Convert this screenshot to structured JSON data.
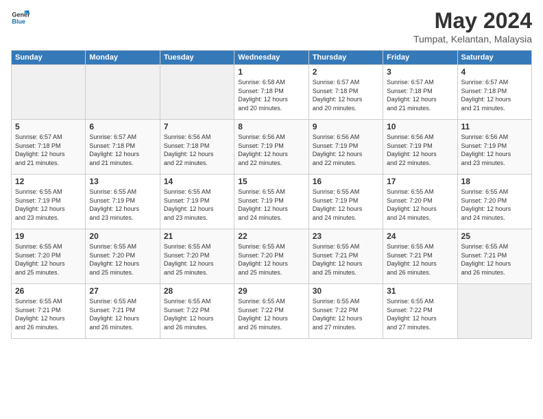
{
  "header": {
    "logo_line1": "General",
    "logo_line2": "Blue",
    "month": "May 2024",
    "location": "Tumpat, Kelantan, Malaysia"
  },
  "weekdays": [
    "Sunday",
    "Monday",
    "Tuesday",
    "Wednesday",
    "Thursday",
    "Friday",
    "Saturday"
  ],
  "weeks": [
    [
      {
        "day": "",
        "info": ""
      },
      {
        "day": "",
        "info": ""
      },
      {
        "day": "",
        "info": ""
      },
      {
        "day": "1",
        "info": "Sunrise: 6:58 AM\nSunset: 7:18 PM\nDaylight: 12 hours\nand 20 minutes."
      },
      {
        "day": "2",
        "info": "Sunrise: 6:57 AM\nSunset: 7:18 PM\nDaylight: 12 hours\nand 20 minutes."
      },
      {
        "day": "3",
        "info": "Sunrise: 6:57 AM\nSunset: 7:18 PM\nDaylight: 12 hours\nand 21 minutes."
      },
      {
        "day": "4",
        "info": "Sunrise: 6:57 AM\nSunset: 7:18 PM\nDaylight: 12 hours\nand 21 minutes."
      }
    ],
    [
      {
        "day": "5",
        "info": "Sunrise: 6:57 AM\nSunset: 7:18 PM\nDaylight: 12 hours\nand 21 minutes."
      },
      {
        "day": "6",
        "info": "Sunrise: 6:57 AM\nSunset: 7:18 PM\nDaylight: 12 hours\nand 21 minutes."
      },
      {
        "day": "7",
        "info": "Sunrise: 6:56 AM\nSunset: 7:18 PM\nDaylight: 12 hours\nand 22 minutes."
      },
      {
        "day": "8",
        "info": "Sunrise: 6:56 AM\nSunset: 7:19 PM\nDaylight: 12 hours\nand 22 minutes."
      },
      {
        "day": "9",
        "info": "Sunrise: 6:56 AM\nSunset: 7:19 PM\nDaylight: 12 hours\nand 22 minutes."
      },
      {
        "day": "10",
        "info": "Sunrise: 6:56 AM\nSunset: 7:19 PM\nDaylight: 12 hours\nand 22 minutes."
      },
      {
        "day": "11",
        "info": "Sunrise: 6:56 AM\nSunset: 7:19 PM\nDaylight: 12 hours\nand 23 minutes."
      }
    ],
    [
      {
        "day": "12",
        "info": "Sunrise: 6:55 AM\nSunset: 7:19 PM\nDaylight: 12 hours\nand 23 minutes."
      },
      {
        "day": "13",
        "info": "Sunrise: 6:55 AM\nSunset: 7:19 PM\nDaylight: 12 hours\nand 23 minutes."
      },
      {
        "day": "14",
        "info": "Sunrise: 6:55 AM\nSunset: 7:19 PM\nDaylight: 12 hours\nand 23 minutes."
      },
      {
        "day": "15",
        "info": "Sunrise: 6:55 AM\nSunset: 7:19 PM\nDaylight: 12 hours\nand 24 minutes."
      },
      {
        "day": "16",
        "info": "Sunrise: 6:55 AM\nSunset: 7:19 PM\nDaylight: 12 hours\nand 24 minutes."
      },
      {
        "day": "17",
        "info": "Sunrise: 6:55 AM\nSunset: 7:20 PM\nDaylight: 12 hours\nand 24 minutes."
      },
      {
        "day": "18",
        "info": "Sunrise: 6:55 AM\nSunset: 7:20 PM\nDaylight: 12 hours\nand 24 minutes."
      }
    ],
    [
      {
        "day": "19",
        "info": "Sunrise: 6:55 AM\nSunset: 7:20 PM\nDaylight: 12 hours\nand 25 minutes."
      },
      {
        "day": "20",
        "info": "Sunrise: 6:55 AM\nSunset: 7:20 PM\nDaylight: 12 hours\nand 25 minutes."
      },
      {
        "day": "21",
        "info": "Sunrise: 6:55 AM\nSunset: 7:20 PM\nDaylight: 12 hours\nand 25 minutes."
      },
      {
        "day": "22",
        "info": "Sunrise: 6:55 AM\nSunset: 7:20 PM\nDaylight: 12 hours\nand 25 minutes."
      },
      {
        "day": "23",
        "info": "Sunrise: 6:55 AM\nSunset: 7:21 PM\nDaylight: 12 hours\nand 25 minutes."
      },
      {
        "day": "24",
        "info": "Sunrise: 6:55 AM\nSunset: 7:21 PM\nDaylight: 12 hours\nand 26 minutes."
      },
      {
        "day": "25",
        "info": "Sunrise: 6:55 AM\nSunset: 7:21 PM\nDaylight: 12 hours\nand 26 minutes."
      }
    ],
    [
      {
        "day": "26",
        "info": "Sunrise: 6:55 AM\nSunset: 7:21 PM\nDaylight: 12 hours\nand 26 minutes."
      },
      {
        "day": "27",
        "info": "Sunrise: 6:55 AM\nSunset: 7:21 PM\nDaylight: 12 hours\nand 26 minutes."
      },
      {
        "day": "28",
        "info": "Sunrise: 6:55 AM\nSunset: 7:22 PM\nDaylight: 12 hours\nand 26 minutes."
      },
      {
        "day": "29",
        "info": "Sunrise: 6:55 AM\nSunset: 7:22 PM\nDaylight: 12 hours\nand 26 minutes."
      },
      {
        "day": "30",
        "info": "Sunrise: 6:55 AM\nSunset: 7:22 PM\nDaylight: 12 hours\nand 27 minutes."
      },
      {
        "day": "31",
        "info": "Sunrise: 6:55 AM\nSunset: 7:22 PM\nDaylight: 12 hours\nand 27 minutes."
      },
      {
        "day": "",
        "info": ""
      }
    ]
  ]
}
